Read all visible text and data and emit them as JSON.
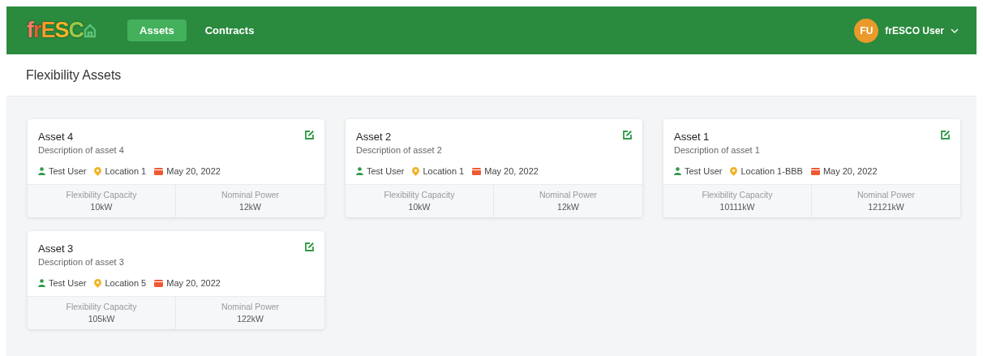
{
  "logo": {
    "letters": [
      {
        "text": "f",
        "color": "#ff7a66"
      },
      {
        "text": "r",
        "color": "#ee5a34"
      },
      {
        "text": "E",
        "color": "#f39a2c"
      },
      {
        "text": "S",
        "color": "#f5b32a"
      },
      {
        "text": "C",
        "color": "#9cc94a"
      }
    ]
  },
  "nav": [
    {
      "label": "Assets",
      "selected": true
    },
    {
      "label": "Contracts",
      "selected": false
    }
  ],
  "user": {
    "initials": "FU",
    "name": "frESCO User"
  },
  "page_title": "Flexibility Assets",
  "assets": [
    {
      "title": "Asset 4",
      "description": "Description of asset 4",
      "owner": "Test User",
      "location": "Location 1",
      "date": "May 20, 2022",
      "stats": [
        {
          "label": "Flexibility Capacity",
          "value": "10kW"
        },
        {
          "label": "Nominal Power",
          "value": "12kW"
        }
      ]
    },
    {
      "title": "Asset 2",
      "description": "Description of asset 2",
      "owner": "Test User",
      "location": "Location 1",
      "date": "May 20, 2022",
      "stats": [
        {
          "label": "Flexibility Capacity",
          "value": "10kW"
        },
        {
          "label": "Nominal Power",
          "value": "12kW"
        }
      ]
    },
    {
      "title": "Asset 1",
      "description": "Description of asset 1",
      "owner": "Test User",
      "location": "Location 1-BBB",
      "date": "May 20, 2022",
      "stats": [
        {
          "label": "Flexibility Capacity",
          "value": "10111kW"
        },
        {
          "label": "Nominal Power",
          "value": "12121kW"
        }
      ]
    },
    {
      "title": "Asset 3",
      "description": "Description of asset 3",
      "owner": "Test User",
      "location": "Location 5",
      "date": "May 20, 2022",
      "stats": [
        {
          "label": "Flexibility Capacity",
          "value": "105kW"
        },
        {
          "label": "Nominal Power",
          "value": "122kW"
        }
      ]
    }
  ]
}
